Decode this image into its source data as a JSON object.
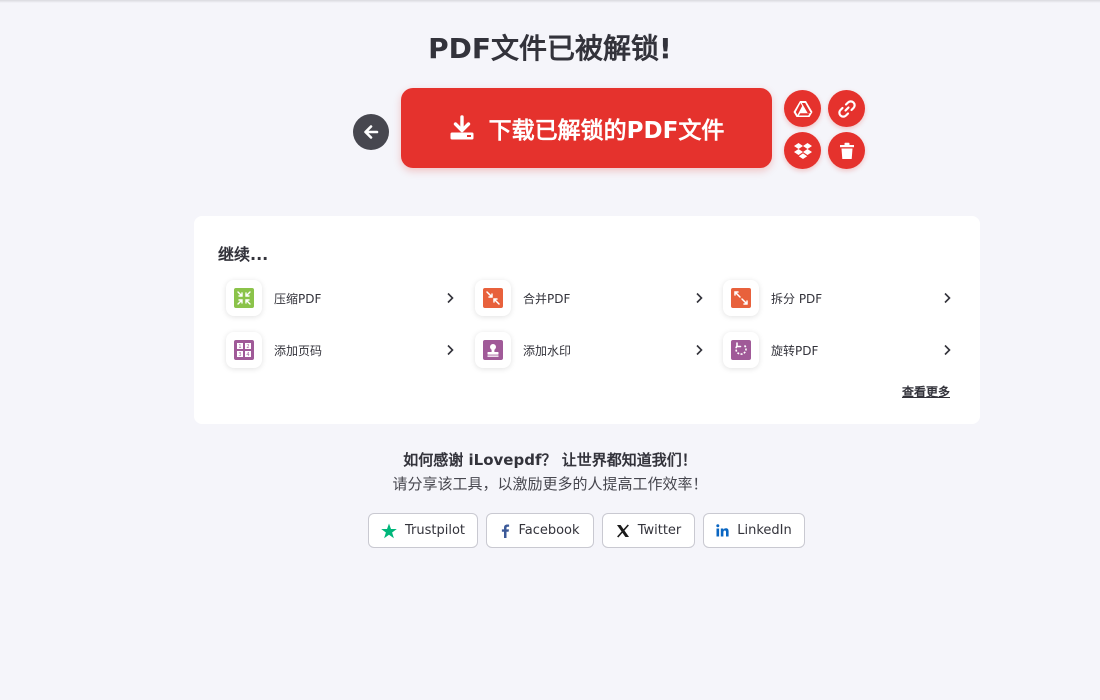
{
  "header": {
    "title": "PDF文件已被解锁!"
  },
  "actions": {
    "download_label": "下载已解锁的PDF文件"
  },
  "colors": {
    "brand_red": "#e5322d",
    "dark": "#47474f",
    "compress_green": "#8bc34a",
    "orange": "#e8613c",
    "purple": "#a05a98",
    "trustpilot_green": "#00b67a",
    "facebook_blue": "#3b5998",
    "linkedin_blue": "#0a66c2"
  },
  "continue_section": {
    "title": "继续...",
    "tools": [
      {
        "label": "压缩PDF",
        "icon": "compress-icon"
      },
      {
        "label": "合并PDF",
        "icon": "merge-icon"
      },
      {
        "label": "拆分 PDF",
        "icon": "split-icon"
      },
      {
        "label": "添加页码",
        "icon": "page-numbers-icon"
      },
      {
        "label": "添加水印",
        "icon": "watermark-icon"
      },
      {
        "label": "旋转PDF",
        "icon": "rotate-icon"
      }
    ],
    "see_more": "查看更多"
  },
  "share": {
    "thanks": "如何感谢 iLovepdf？ 让世界都知道我们！",
    "subtitle": "请分享该工具，以激励更多的人提高工作效率！",
    "buttons": [
      {
        "label": "Trustpilot",
        "icon": "trustpilot-star-icon"
      },
      {
        "label": "Facebook",
        "icon": "facebook-icon"
      },
      {
        "label": "Twitter",
        "icon": "x-twitter-icon"
      },
      {
        "label": "LinkedIn",
        "icon": "linkedin-icon"
      }
    ]
  }
}
